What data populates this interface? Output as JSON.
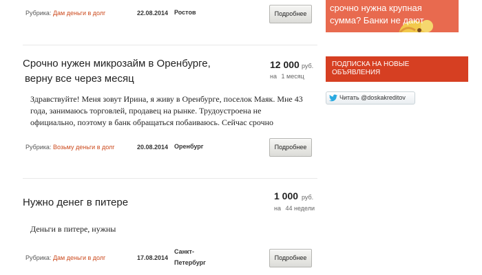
{
  "listings": [
    {
      "rubric_label": "Рубрика:",
      "rubric_link": "Дам деньги в долг",
      "date": "22.08.2014",
      "city": "Ростов",
      "button": "Подробнее"
    },
    {
      "title_line1": "Срочно нужен микрозайм в Оренбурге,",
      "title_line2": "верну все через месяц",
      "price": "12 000",
      "currency": "руб.",
      "term_prefix": "на",
      "term": "1 месяц",
      "text_line1": "Здравствуйте! Меня зовут Ирина, я живу в Оренбурге, поселок Маяк. Мне 43",
      "text_line2": "года, занимаюсь торговлей, продавец на рынке. Трудоустроена не",
      "text_line3": "официально, поэтому в банк обращаться побаиваюсь. Сейчас срочно",
      "rubric_label": "Рубрика:",
      "rubric_link": "Возьму деньги в долг",
      "date": "20.08.2014",
      "city": "Оренбург",
      "button": "Подробнее"
    },
    {
      "title_line1": "Нужно денег в питере",
      "price": "1 000",
      "currency": "руб.",
      "term_prefix": "на",
      "term": "44 недели",
      "text_line1": "Деньги в питере, нужны",
      "rubric_label": "Рубрика:",
      "rubric_link": "Дам деньги в долг",
      "date": "17.08.2014",
      "city_line1": "Санкт-",
      "city_line2": "Петербург",
      "button": "Подробнее"
    }
  ],
  "sidebar": {
    "promo_line1": "срочно нужна крупная",
    "promo_line2": "сумма? Банки не дают",
    "subscribe_line1": "ПОДПИСКА НА НОВЫЕ",
    "subscribe_line2": "ОБЪЯВЛЕНИЯ",
    "twitter_label": "Читать @doskakreditov",
    "twitter_icon": "twitter-bird-icon"
  },
  "colors": {
    "link": "#cc4a1d",
    "promo_bg": "#e86a4f",
    "subscribe_bg": "#d63f22",
    "twitter_blue": "#2aa9e0"
  }
}
